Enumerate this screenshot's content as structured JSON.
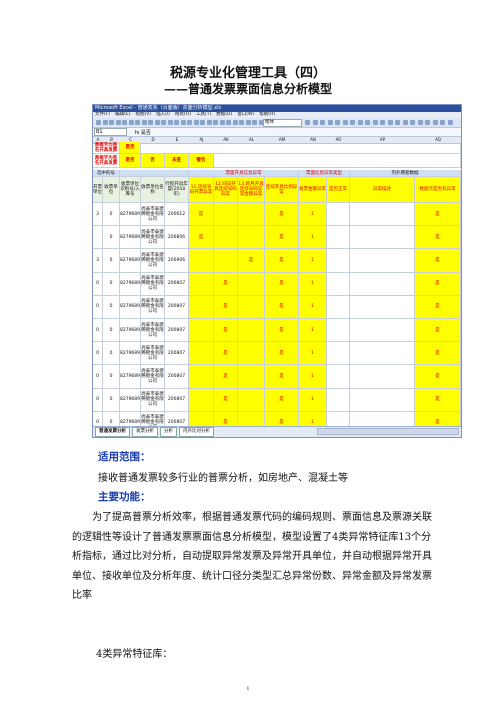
{
  "title": "税源专业化管理工具（四）",
  "subtitle": "——普通发票票面信息分析模型",
  "screenshot": {
    "window_title": "Microsoft Excel - 普通发票（页面版）票面分析模型.xls",
    "menu": [
      "文件(F)",
      "编辑(E)",
      "视图(V)",
      "插入(I)",
      "格式(O)",
      "工具(T)",
      "数据(D)",
      "窗口(W)",
      "帮助(H)"
    ],
    "font_box": "楷体",
    "name_box": "B1",
    "formula": "fx  是否",
    "columns": [
      "A",
      "B",
      "C",
      "D",
      "E",
      "AJ",
      "AK",
      "AL",
      "AM",
      "AN",
      "AO",
      "AP",
      "AQ"
    ],
    "legend_rows": [
      {
        "label": "黑框字为签名开具发票",
        "value": "是否"
      },
      {
        "label": "黑框字为签名开具发票",
        "values": [
          "是否",
          "否",
          "未签",
          "警告"
        ]
      }
    ],
    "group_headers": [
      "选中的号",
      "票面开具信息异常",
      "票面信息异常类型",
      "内外两套数据",
      "票面信息异常类型"
    ],
    "col_headers": [
      "开票单位",
      "收票单位",
      "收票单位识别号/入库号",
      "收票单位名称",
      "行程开具年度(2010年)",
      "11.连续号码开票异常",
      "12.同日开具连续号码异常",
      "13.跨月开具连续号码异常金额异常",
      "连续开具比例异常",
      "发票金额异常",
      "是否正常",
      "异常描述",
      "数据元是否有异常"
    ],
    "rows": [
      {
        "a": "3",
        "b": "0",
        "id": "330682796896976",
        "name": "尚泰市泰建腾镀金有限公司",
        "year": "200612",
        "flags": [
          "是",
          "",
          "",
          "是",
          "1",
          "是"
        ]
      },
      {
        "a": "",
        "b": "0",
        "id": "330682796896976",
        "name": "尚泰市泰建腾镀金有限公司",
        "year": "200806",
        "flags": [
          "是",
          "",
          "",
          "是",
          "1",
          "是"
        ]
      },
      {
        "a": "3",
        "b": "0",
        "id": "330682796896976",
        "name": "尚泰市泰建腾镀金有限公司",
        "year": "200906",
        "flags": [
          "",
          "",
          "是",
          "是",
          "1",
          "是"
        ]
      },
      {
        "a": "0",
        "b": "0",
        "id": "330682796896976",
        "name": "尚泰市泰建腾镀金有限公司",
        "year": "200807",
        "flags": [
          "",
          "是",
          "",
          "是",
          "1",
          "是"
        ]
      },
      {
        "a": "0",
        "b": "0",
        "id": "330682796896976",
        "name": "尚泰市泰建腾镀金有限公司",
        "year": "200807",
        "flags": [
          "",
          "是",
          "",
          "是",
          "1",
          "是"
        ]
      },
      {
        "a": "0",
        "b": "0",
        "id": "330682796896976",
        "name": "尚泰市泰建腾镀金有限公司",
        "year": "200807",
        "flags": [
          "",
          "是",
          "",
          "是",
          "1",
          "是"
        ]
      },
      {
        "a": "0",
        "b": "0",
        "id": "330682796896976",
        "name": "尚泰市泰建腾镀金有限公司",
        "year": "200807",
        "flags": [
          "",
          "是",
          "",
          "是",
          "1",
          "是"
        ]
      },
      {
        "a": "0",
        "b": "0",
        "id": "330682796896976",
        "name": "尚泰市泰建腾镀金有限公司",
        "year": "200807",
        "flags": [
          "",
          "是",
          "",
          "是",
          "1",
          "是"
        ]
      },
      {
        "a": "0",
        "b": "0",
        "id": "330682796896976",
        "name": "尚泰市泰建腾镀金有限公司",
        "year": "200807",
        "flags": [
          "",
          "是",
          "",
          "是",
          "1",
          "是"
        ]
      },
      {
        "a": "0",
        "b": "0",
        "id": "330682796896976",
        "name": "尚泰市泰建腾镀金有限公司",
        "year": "200807",
        "flags": [
          "",
          "是",
          "",
          "是",
          "1",
          "是"
        ]
      }
    ],
    "sheet_tabs": [
      "普通发票分析",
      "发票分析",
      "分析",
      "内外比对分析"
    ]
  },
  "section1_heading": "适用范围：",
  "section1_text": "接收普通发票较多行业的普票分析，如房地产、混凝土等",
  "section2_heading": "主要功能：",
  "section2_text": "为了提高普票分析效率，根据普通发票代码的编码规则、票面信息及票源关联的逻辑性等设计了普通发票票面信息分析模型，模型设置了4类异常特征库13个分析指标，通过比对分析，自动提取异常发票及异常开具单位，并自动根据异常开具单位、接收单位及分析年度、统计口径分类型汇总异常份数、异常金额及异常发票比率",
  "section3_text": "4类异常特征库：",
  "page_number": "1",
  "colors": {
    "heading_blue": "#1a3fb0",
    "excel_yellow": "#ffff00",
    "excel_red": "#e00000",
    "title_bar": "#2b4f9e"
  }
}
